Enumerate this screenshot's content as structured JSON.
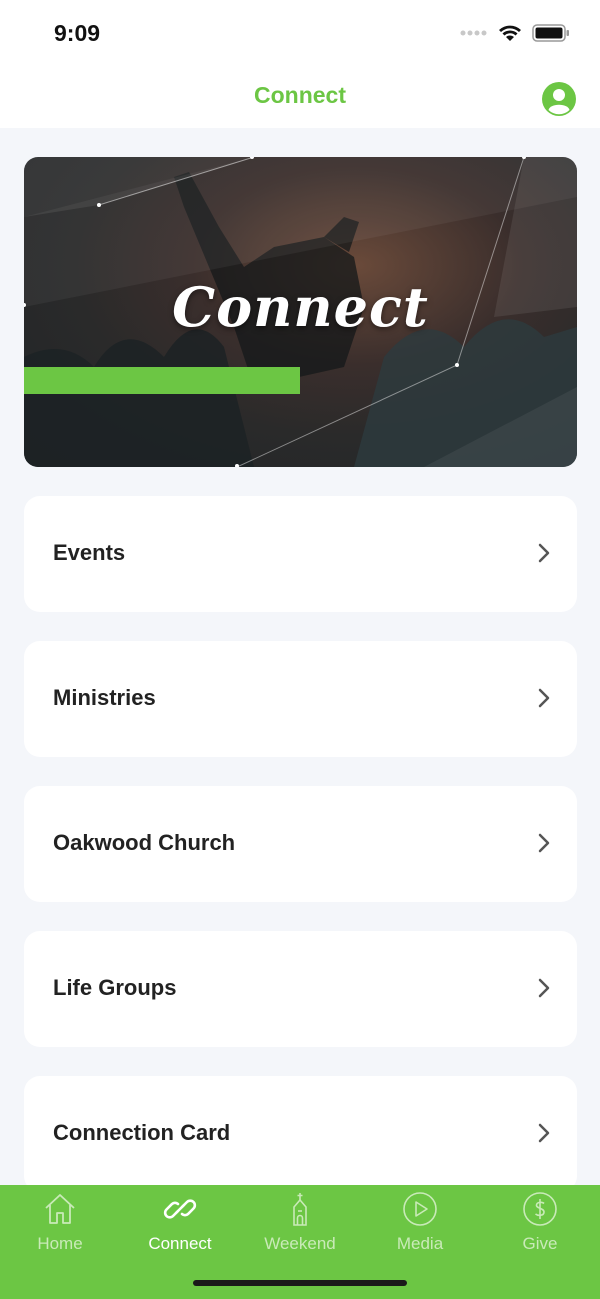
{
  "colors": {
    "accent": "#6cc644",
    "tab_bar_bg": "#6cc644",
    "tab_active": "#ffffff",
    "tab_inactive": "#c9eab8",
    "background": "#f4f6fa"
  },
  "status_bar": {
    "time": "9:09",
    "icons": [
      "signal-dots-icon",
      "wifi-icon",
      "battery-icon"
    ]
  },
  "nav": {
    "title": "Connect",
    "profile_icon": "user-circle-icon"
  },
  "hero": {
    "title": "Connect"
  },
  "menu": {
    "items": [
      {
        "label": "Events"
      },
      {
        "label": "Ministries"
      },
      {
        "label": "Oakwood Church"
      },
      {
        "label": "Life Groups"
      },
      {
        "label": "Connection Card"
      }
    ]
  },
  "tabs": [
    {
      "label": "Home",
      "icon": "home-icon",
      "active": false
    },
    {
      "label": "Connect",
      "icon": "link-icon",
      "active": true
    },
    {
      "label": "Weekend",
      "icon": "church-icon",
      "active": false
    },
    {
      "label": "Media",
      "icon": "play-circle-icon",
      "active": false
    },
    {
      "label": "Give",
      "icon": "dollar-circle-icon",
      "active": false
    }
  ]
}
